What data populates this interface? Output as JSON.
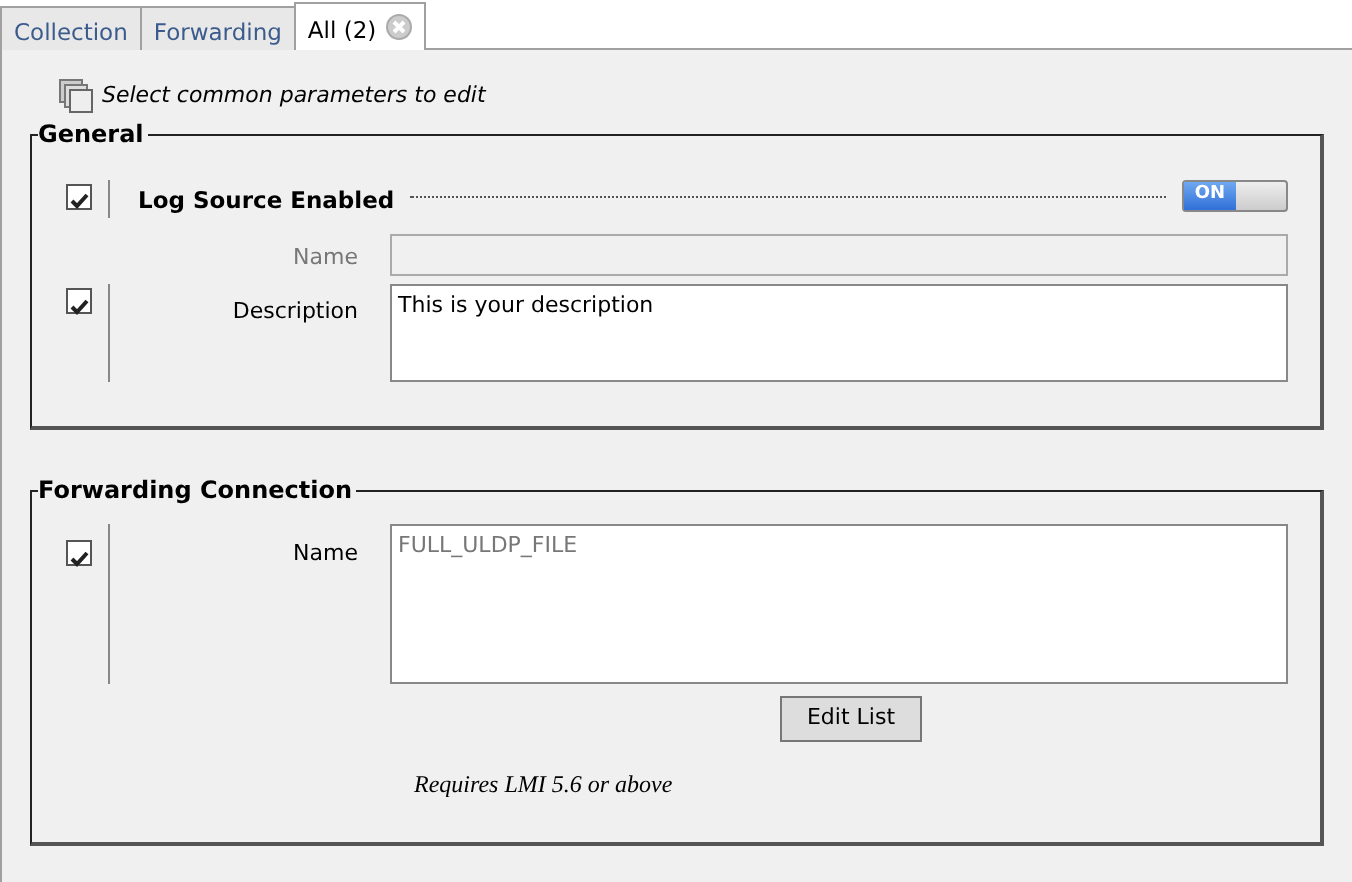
{
  "tabs": [
    {
      "label": "Collection",
      "selected": false,
      "closable": false
    },
    {
      "label": "Forwarding",
      "selected": false,
      "closable": false
    },
    {
      "label": "All (2)",
      "selected": true,
      "closable": true
    }
  ],
  "hint": "Select common parameters to edit",
  "groups": [
    {
      "title": "General",
      "rows": [
        {
          "kind": "toggle",
          "checked": true,
          "label": "Log Source Enabled",
          "on": true,
          "toggle_text": "ON"
        },
        {
          "kind": "field",
          "label": "Name",
          "disabled": true
        },
        {
          "kind": "textarea",
          "checked": true,
          "label": "Description",
          "value": "This is your description",
          "disabled": false
        }
      ]
    },
    {
      "title": "Forwarding Connection",
      "rows": [
        {
          "kind": "list",
          "checked": true,
          "label": "Name",
          "value": "FULL_ULDP_FILE",
          "disabled": true,
          "button": "Edit List",
          "note": "Requires LMI 5.6 or above"
        }
      ]
    }
  ]
}
